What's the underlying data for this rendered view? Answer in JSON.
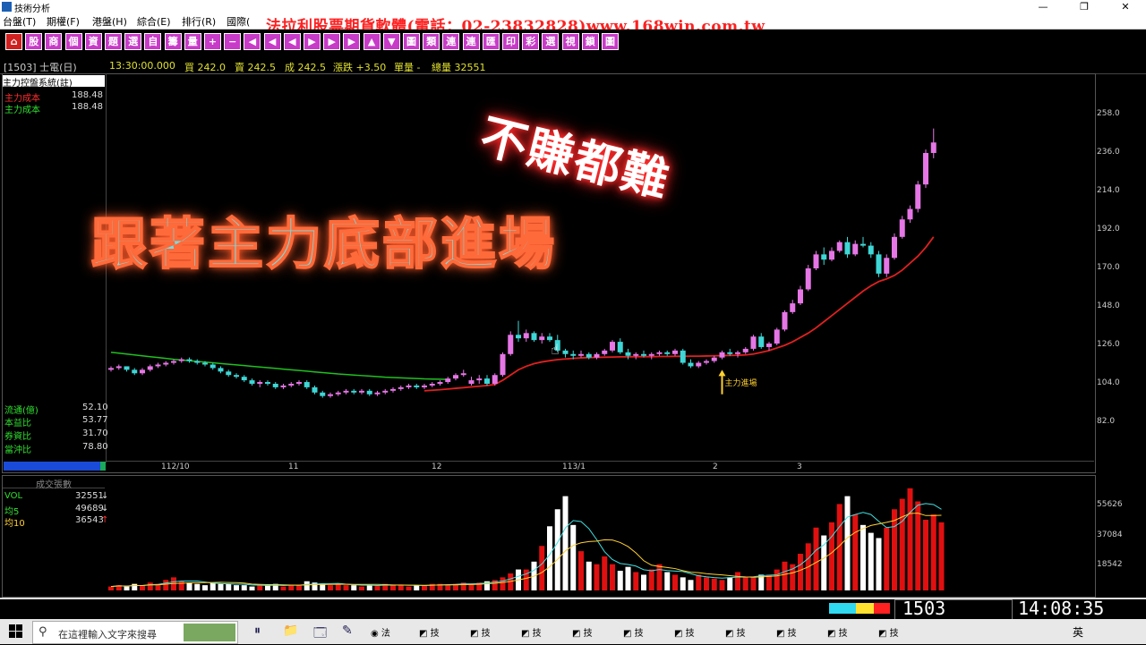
{
  "window": {
    "title": "技術分析",
    "buttons": [
      "—",
      "❐",
      "✕"
    ]
  },
  "menu": {
    "items": [
      "台盤(T)",
      "期權(F)",
      "港盤(H)",
      "綜合(E)",
      "排行(R)",
      "國際("
    ],
    "ad_text": "法拉利股票期貨軟體(電話：02-23832828)www.168win.com.tw"
  },
  "toolbar": {
    "buttons": [
      "⌂",
      "股",
      "商",
      "個",
      "資",
      "題",
      "選",
      "自",
      "籌",
      "量",
      "+",
      "−",
      "◀",
      "◀",
      "◀",
      "▶",
      "▶",
      "▶",
      "▲",
      "▼",
      "圖",
      "類",
      "連",
      "連",
      "匯",
      "印",
      "彩",
      "選",
      "視",
      "鎖",
      "圖"
    ]
  },
  "quote": {
    "code_name": "[1503] 士電(日)",
    "time": "13:30:00.000",
    "buy": "買 242.0",
    "sell": "賣 242.5",
    "deal": "成 242.5",
    "change": "漲跌 +3.50",
    "single_vol": "單量 -",
    "total_vol": "總量 32551"
  },
  "indicator": {
    "title": "主力控盤系統(註)",
    "rows": [
      {
        "label": "主力成本",
        "value": "188.48",
        "color": "#ff3030"
      },
      {
        "label": "主力成本",
        "value": "188.48",
        "color": "#30e030"
      }
    ]
  },
  "stats": [
    {
      "label": "流通(億)",
      "value": "52.10"
    },
    {
      "label": "本益比",
      "value": "53.77"
    },
    {
      "label": "券資比",
      "value": "31.70"
    },
    {
      "label": "當沖比",
      "value": "78.80"
    }
  ],
  "price_axis": [
    "258.0",
    "236.0",
    "214.0",
    "192.0",
    "170.0",
    "148.0",
    "126.0",
    "104.0",
    "82.0"
  ],
  "date_axis": [
    "112/10",
    "11",
    "12",
    "113/1",
    "2",
    "3"
  ],
  "annotation": "主力進場",
  "overlays": {
    "top_right": "不賺都難",
    "main": "跟著主力底部進場"
  },
  "volume_panel": {
    "title": "成交張數",
    "rows": [
      {
        "label": "VOL",
        "value": "32551",
        "marker": "↓",
        "color": "#30e030"
      },
      {
        "label": "均5",
        "value": "49689",
        "marker": "↓",
        "color": "#30e030"
      },
      {
        "label": "均10",
        "value": "36543",
        "marker": "↑",
        "color": "#ffd030"
      }
    ],
    "axis": [
      "55626",
      "37084",
      "18542"
    ]
  },
  "status": {
    "code": "1503",
    "clock": "14:08:35"
  },
  "taskbar": {
    "search_placeholder": "在這裡輸入文字來搜尋",
    "app_label": "技",
    "first_app": "法",
    "ime": "英"
  },
  "colors": {
    "up": "#e676e6",
    "down": "#3ed6d6",
    "cost_line": "#e02020",
    "ma_line": "#20c020",
    "vol_up": "#e01010",
    "vol_down": "#ffffff"
  },
  "chart_data": {
    "type": "candlestick",
    "symbol": "1503",
    "ylim": [
      82,
      258
    ],
    "candles": [
      [
        112,
        114,
        111,
        113
      ],
      [
        113,
        115,
        112,
        114
      ],
      [
        114,
        114,
        111,
        112
      ],
      [
        112,
        113,
        109,
        110
      ],
      [
        110,
        113,
        109,
        112
      ],
      [
        112,
        115,
        111,
        114
      ],
      [
        114,
        116,
        113,
        115
      ],
      [
        115,
        117,
        114,
        116
      ],
      [
        116,
        118,
        115,
        117
      ],
      [
        117,
        119,
        116,
        118
      ],
      [
        118,
        119,
        116,
        117
      ],
      [
        117,
        118,
        115,
        116
      ],
      [
        116,
        117,
        114,
        115
      ],
      [
        115,
        116,
        112,
        113
      ],
      [
        113,
        114,
        110,
        111
      ],
      [
        111,
        112,
        108,
        109
      ],
      [
        109,
        110,
        107,
        108
      ],
      [
        108,
        109,
        105,
        106
      ],
      [
        106,
        107,
        103,
        104
      ],
      [
        104,
        106,
        102,
        105
      ],
      [
        105,
        106,
        103,
        104
      ],
      [
        104,
        105,
        101,
        102
      ],
      [
        102,
        104,
        101,
        103
      ],
      [
        103,
        105,
        102,
        104
      ],
      [
        104,
        106,
        103,
        105
      ],
      [
        105,
        106,
        101,
        102
      ],
      [
        102,
        103,
        98,
        99
      ],
      [
        99,
        100,
        96,
        97
      ],
      [
        97,
        99,
        96,
        98
      ],
      [
        98,
        100,
        97,
        99
      ],
      [
        99,
        101,
        98,
        100
      ],
      [
        100,
        101,
        98,
        99
      ],
      [
        99,
        101,
        98,
        100
      ],
      [
        100,
        101,
        97,
        98
      ],
      [
        98,
        100,
        97,
        99
      ],
      [
        99,
        101,
        98,
        100
      ],
      [
        100,
        102,
        99,
        101
      ],
      [
        101,
        103,
        100,
        102
      ],
      [
        102,
        104,
        101,
        103
      ],
      [
        103,
        104,
        101,
        102
      ],
      [
        102,
        104,
        101,
        103
      ],
      [
        103,
        105,
        102,
        104
      ],
      [
        104,
        106,
        103,
        105
      ],
      [
        105,
        108,
        104,
        107
      ],
      [
        107,
        110,
        106,
        109
      ],
      [
        109,
        112,
        108,
        110
      ],
      [
        104,
        108,
        103,
        106
      ],
      [
        106,
        109,
        104,
        107
      ],
      [
        107,
        109,
        103,
        104
      ],
      [
        104,
        110,
        103,
        109
      ],
      [
        109,
        122,
        108,
        121
      ],
      [
        121,
        134,
        120,
        132
      ],
      [
        132,
        140,
        128,
        130
      ],
      [
        130,
        135,
        128,
        133
      ],
      [
        133,
        134,
        128,
        129
      ],
      [
        129,
        133,
        127,
        131
      ],
      [
        131,
        133,
        128,
        129
      ],
      [
        129,
        132,
        122,
        123
      ],
      [
        123,
        124,
        119,
        121
      ],
      [
        121,
        123,
        118,
        120
      ],
      [
        120,
        123,
        119,
        121
      ],
      [
        121,
        122,
        118,
        119
      ],
      [
        119,
        122,
        118,
        121
      ],
      [
        121,
        124,
        120,
        123
      ],
      [
        123,
        129,
        122,
        128
      ],
      [
        128,
        130,
        121,
        122
      ],
      [
        122,
        124,
        118,
        120
      ],
      [
        120,
        122,
        118,
        121
      ],
      [
        121,
        123,
        119,
        120
      ],
      [
        120,
        122,
        118,
        121
      ],
      [
        121,
        123,
        120,
        122
      ],
      [
        122,
        123,
        120,
        121
      ],
      [
        121,
        124,
        120,
        123
      ],
      [
        123,
        124,
        115,
        116
      ],
      [
        116,
        118,
        113,
        114
      ],
      [
        114,
        117,
        113,
        116
      ],
      [
        116,
        118,
        115,
        117
      ],
      [
        117,
        120,
        116,
        119
      ],
      [
        119,
        123,
        118,
        122
      ],
      [
        122,
        124,
        120,
        121
      ],
      [
        121,
        123,
        119,
        122
      ],
      [
        122,
        125,
        121,
        124
      ],
      [
        124,
        132,
        123,
        131
      ],
      [
        131,
        133,
        124,
        125
      ],
      [
        125,
        128,
        123,
        127
      ],
      [
        127,
        136,
        126,
        135
      ],
      [
        135,
        146,
        134,
        145
      ],
      [
        145,
        152,
        144,
        150
      ],
      [
        150,
        160,
        149,
        158
      ],
      [
        158,
        172,
        157,
        170
      ],
      [
        170,
        180,
        169,
        178
      ],
      [
        178,
        182,
        172,
        175
      ],
      [
        175,
        182,
        174,
        180
      ],
      [
        180,
        186,
        179,
        185
      ],
      [
        185,
        188,
        176,
        178
      ],
      [
        178,
        186,
        177,
        184
      ],
      [
        184,
        188,
        182,
        183
      ],
      [
        183,
        185,
        176,
        178
      ],
      [
        178,
        180,
        165,
        167
      ],
      [
        167,
        178,
        165,
        176
      ],
      [
        176,
        190,
        175,
        188
      ],
      [
        188,
        200,
        187,
        198
      ],
      [
        198,
        206,
        196,
        204
      ],
      [
        204,
        220,
        202,
        218
      ],
      [
        218,
        238,
        216,
        236
      ],
      [
        236,
        250,
        233,
        242
      ]
    ],
    "cost_line": [
      98,
      98,
      98,
      98,
      98,
      98,
      98,
      98,
      98,
      98,
      98,
      98,
      98,
      98,
      98,
      98,
      98,
      98,
      98,
      98,
      98,
      98,
      98,
      98,
      98,
      98,
      98,
      98,
      98,
      98,
      98,
      98,
      98,
      98,
      98,
      98,
      98,
      98,
      98,
      98,
      100,
      100.3,
      100.6,
      101,
      101.4,
      101.8,
      102.2,
      102.6,
      103,
      103.6,
      106,
      109,
      112,
      114,
      115.5,
      116.5,
      117.2,
      117.8,
      118.2,
      118.5,
      118.8,
      119,
      119.1,
      119.2,
      119.3,
      119.4,
      119.4,
      119.5,
      119.5,
      119.5,
      119.6,
      119.6,
      119.7,
      119.7,
      119.8,
      119.8,
      119.9,
      120,
      120.1,
      120.2,
      120.3,
      120.5,
      121,
      122,
      123,
      124.5,
      126,
      128,
      130.5,
      133,
      136,
      139.5,
      143,
      146.5,
      150,
      153.5,
      157,
      160,
      162.5,
      164,
      166,
      169,
      173,
      177,
      182,
      188
    ],
    "ma_line_start": 0,
    "ma_line": [
      122,
      121.5,
      121,
      120.5,
      120,
      119.5,
      119,
      118.5,
      118,
      117.6,
      117.2,
      116.8,
      116.4,
      116,
      115.6,
      115.2,
      114.8,
      114.4,
      114,
      113.6,
      113.2,
      112.8,
      112.4,
      112,
      111.6,
      111.2,
      110.8,
      110.4,
      110,
      109.6,
      109.3,
      109,
      108.7,
      108.4,
      108.1,
      107.8,
      107.6,
      107.4,
      107.2,
      107,
      106.8,
      106.7,
      106.6,
      106.5
    ],
    "volume": [
      3,
      4,
      3,
      5,
      4,
      6,
      5,
      8,
      10,
      7,
      6,
      5,
      4,
      6,
      5,
      5,
      4,
      4,
      3,
      4,
      4,
      5,
      3,
      4,
      4,
      7,
      6,
      5,
      4,
      5,
      4,
      4,
      3,
      4,
      4,
      5,
      4,
      4,
      3,
      4,
      4,
      5,
      5,
      4,
      5,
      6,
      5,
      6,
      7,
      8,
      10,
      13,
      16,
      16,
      22,
      34,
      49,
      62,
      72,
      50,
      30,
      22,
      20,
      26,
      20,
      15,
      18,
      14,
      12,
      16,
      20,
      14,
      12,
      10,
      8,
      12,
      10,
      9,
      8,
      10,
      14,
      10,
      10,
      12,
      12,
      16,
      22,
      20,
      28,
      36,
      48,
      42,
      52,
      66,
      72,
      58,
      50,
      44,
      40,
      48,
      62,
      70,
      78,
      68,
      54,
      58,
      52
    ]
  }
}
